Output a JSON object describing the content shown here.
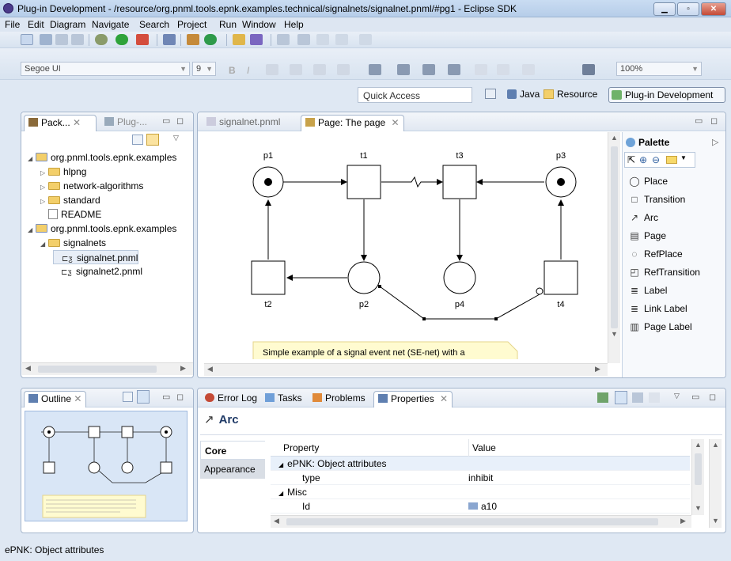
{
  "window": {
    "title": "Plug-in Development - /resource/org.pnml.tools.epnk.examples.technical/signalnets/signalnet.pnml/#pg1 - Eclipse SDK",
    "min": "▁",
    "max": "▫",
    "close": "✕"
  },
  "menu": [
    "File",
    "Edit",
    "Diagram",
    "Navigate",
    "Search",
    "Project",
    "Run",
    "Window",
    "Help"
  ],
  "toolbar2": {
    "font": "Segoe UI",
    "size": "9",
    "bold": "B",
    "italic": "I",
    "zoom": "100%"
  },
  "quick_access": "Quick Access",
  "perspectives": {
    "java": "Java",
    "resource": "Resource",
    "plugin": "Plug-in Development"
  },
  "explorer": {
    "tabs": [
      "Pack...",
      "Plug-..."
    ],
    "items": [
      {
        "label": "org.pnml.tools.epnk.examples",
        "kind": "project",
        "arrow": "◢",
        "level": 0
      },
      {
        "label": "hlpng",
        "kind": "folder",
        "arrow": "▷",
        "level": 1
      },
      {
        "label": "network-algorithms",
        "kind": "folder",
        "arrow": "▷",
        "level": 1
      },
      {
        "label": "standard",
        "kind": "folder",
        "arrow": "▷",
        "level": 1
      },
      {
        "label": "README",
        "kind": "file",
        "arrow": "",
        "level": 1
      },
      {
        "label": "org.pnml.tools.epnk.examples",
        "kind": "project",
        "arrow": "◢",
        "level": 0
      },
      {
        "label": "signalnets",
        "kind": "folder",
        "arrow": "◢",
        "level": 1
      },
      {
        "label": "signalnet.pnml",
        "kind": "pnml",
        "arrow": "",
        "level": 2
      },
      {
        "label": "signalnet2.pnml",
        "kind": "pnml",
        "arrow": "",
        "level": 2
      }
    ]
  },
  "editor": {
    "tabs": [
      "signalnet.pnml",
      "Page: The page"
    ],
    "diagram": {
      "labels": {
        "p1": "p1",
        "t1": "t1",
        "t3": "t3",
        "p3": "p3",
        "t2": "t2",
        "p2": "p2",
        "p4": "p4",
        "t4": "t4"
      },
      "note": "Simple example of a signal event net (SE-net) with a"
    }
  },
  "palette": {
    "title": "Palette",
    "items": [
      {
        "label": "Place",
        "icon": "place-icon",
        "glyph": "◯"
      },
      {
        "label": "Transition",
        "icon": "transition-icon",
        "glyph": "□"
      },
      {
        "label": "Arc",
        "icon": "arc-icon",
        "glyph": "↗"
      },
      {
        "label": "Page",
        "icon": "page-icon",
        "glyph": "▤"
      },
      {
        "label": "RefPlace",
        "icon": "refplace-icon",
        "glyph": "◌"
      },
      {
        "label": "RefTransition",
        "icon": "reftransition-icon",
        "glyph": "◰"
      },
      {
        "label": "Label",
        "icon": "label-icon",
        "glyph": "≣"
      },
      {
        "label": "Link Label",
        "icon": "link-label-icon",
        "glyph": "≣"
      },
      {
        "label": "Page Label",
        "icon": "page-label-icon",
        "glyph": "▥"
      }
    ]
  },
  "outline": {
    "tab": "Outline"
  },
  "bottom": {
    "tabs": [
      "Error Log",
      "Tasks",
      "Problems",
      "Properties"
    ],
    "heading": "Arc",
    "sidetabs": [
      "Core",
      "Appearance"
    ],
    "columns": [
      "Property",
      "Value"
    ],
    "rows": [
      {
        "prop": "ePNK: Object attributes",
        "value": "",
        "group": true
      },
      {
        "prop": "type",
        "value": "inhibit",
        "group": false
      },
      {
        "prop": "Misc",
        "value": "",
        "group": true
      },
      {
        "prop": "Id",
        "value": "a10",
        "group": false
      }
    ]
  },
  "status": "ePNK: Object attributes"
}
